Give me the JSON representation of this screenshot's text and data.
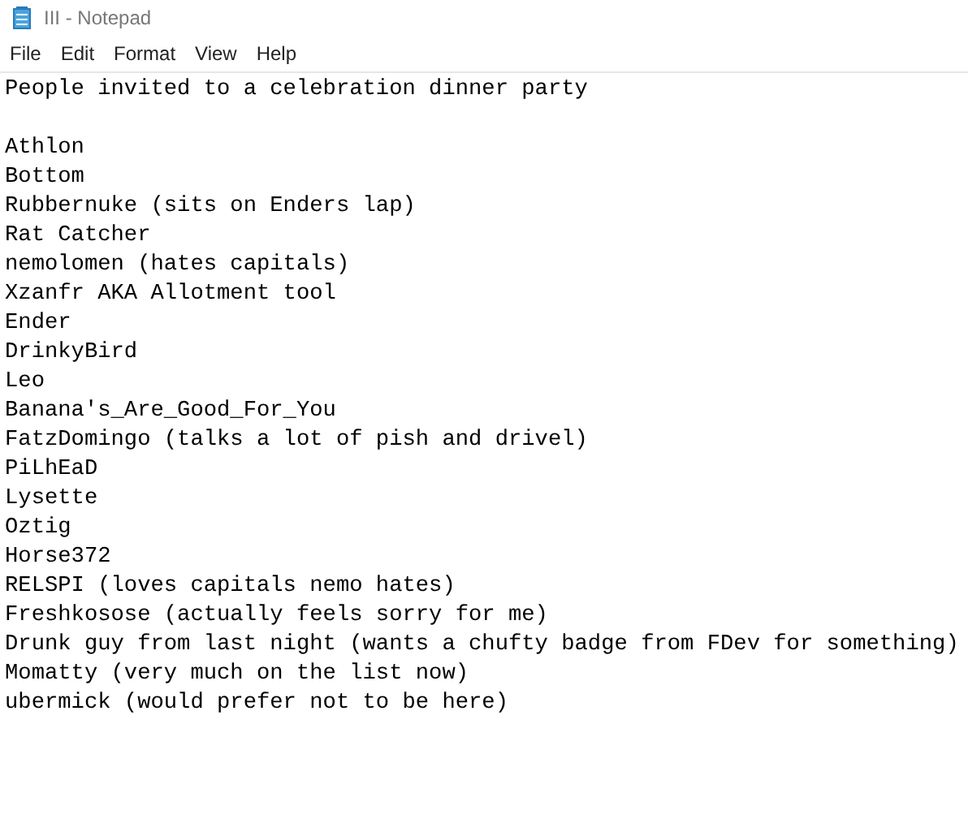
{
  "window": {
    "title": "III - Notepad"
  },
  "menu": [
    "File",
    "Edit",
    "Format",
    "View",
    "Help"
  ],
  "document": {
    "heading": "People invited to a celebration dinner party",
    "lines": [
      "Athlon",
      "Bottom",
      "Rubbernuke (sits on Enders lap)",
      "Rat Catcher",
      "nemolomen (hates capitals)",
      "Xzanfr AKA Allotment tool",
      "Ender",
      "DrinkyBird",
      "Leo",
      "Banana's_Are_Good_For_You",
      "FatzDomingo (talks a lot of pish and drivel)",
      "PiLhEaD",
      "Lysette",
      "Oztig",
      "Horse372",
      "RELSPI (loves capitals nemo hates)",
      "Freshkosose (actually feels sorry for me)",
      "Drunk guy from last night (wants a chufty badge from FDev for something)",
      "Momatty (very much on the list now)",
      "ubermick (would prefer not to be here)"
    ]
  }
}
